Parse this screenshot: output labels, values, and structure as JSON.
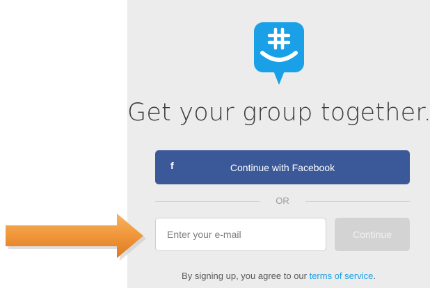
{
  "colors": {
    "brand": "#1aa0e6",
    "facebook": "#3b5998",
    "disabled_button": "#d3d3d3",
    "arrow": "#f1963a"
  },
  "icons": {
    "logo": "groupme-hashtag-chat-icon",
    "facebook": "facebook-f-icon",
    "arrow": "orange-arrow-right-icon"
  },
  "header": {
    "title": "Get your group together."
  },
  "facebook": {
    "icon_glyph": "f",
    "label": "Continue with Facebook"
  },
  "divider": {
    "label": "OR"
  },
  "email": {
    "placeholder": "Enter your e-mail",
    "value": ""
  },
  "continue_button": {
    "label": "Continue"
  },
  "terms": {
    "prefix": "By signing up, you agree to our ",
    "link": "terms of service",
    "suffix": "."
  }
}
